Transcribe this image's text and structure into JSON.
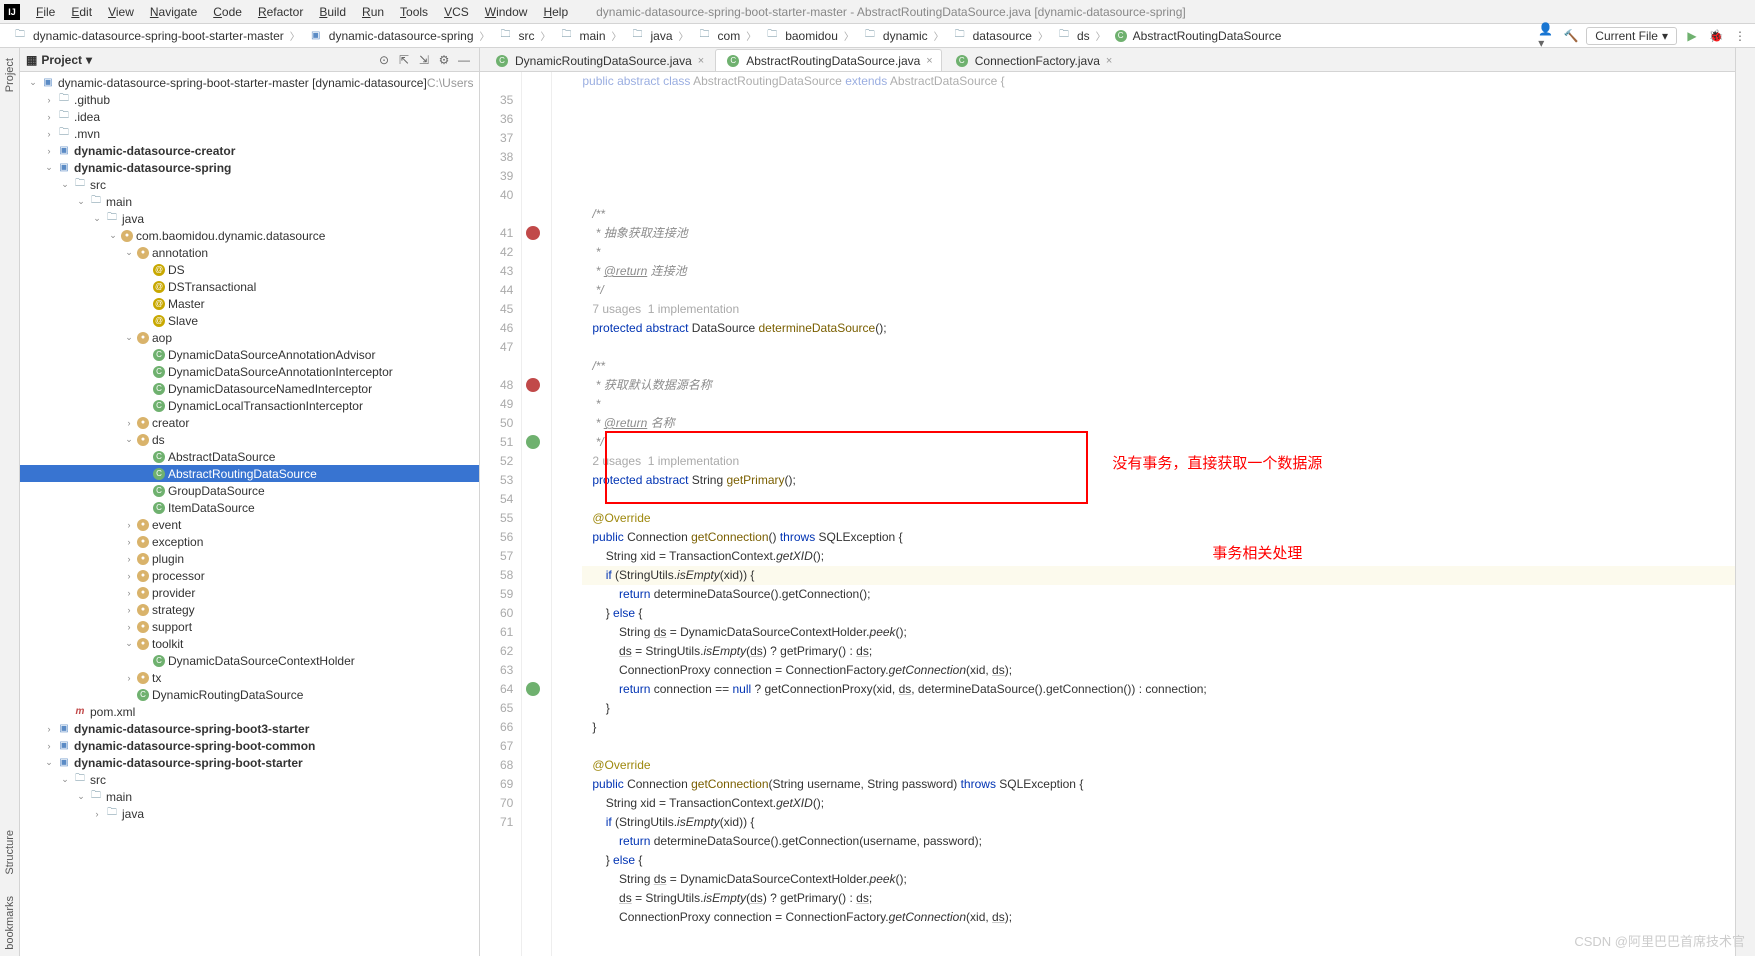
{
  "window": {
    "title": "dynamic-datasource-spring-boot-starter-master - AbstractRoutingDataSource.java [dynamic-datasource-spring]"
  },
  "menu": [
    "File",
    "Edit",
    "View",
    "Navigate",
    "Code",
    "Refactor",
    "Build",
    "Run",
    "Tools",
    "VCS",
    "Window",
    "Help"
  ],
  "breadcrumbs": [
    {
      "label": "dynamic-datasource-spring-boot-starter-master",
      "icon": "folder"
    },
    {
      "label": "dynamic-datasource-spring",
      "icon": "module"
    },
    {
      "label": "src",
      "icon": "folder"
    },
    {
      "label": "main",
      "icon": "folder"
    },
    {
      "label": "java",
      "icon": "folder"
    },
    {
      "label": "com",
      "icon": "folder"
    },
    {
      "label": "baomidou",
      "icon": "folder"
    },
    {
      "label": "dynamic",
      "icon": "folder"
    },
    {
      "label": "datasource",
      "icon": "folder"
    },
    {
      "label": "ds",
      "icon": "folder"
    },
    {
      "label": "AbstractRoutingDataSource",
      "icon": "class"
    }
  ],
  "runConfig": "Current File",
  "panel": {
    "title": "Project"
  },
  "sideTabs": {
    "project": "Project",
    "bookmarks": "bookmarks",
    "structure": "Structure"
  },
  "tree": [
    {
      "d": 0,
      "e": "v",
      "i": "mod",
      "t": "dynamic-datasource-spring-boot-starter-master [dynamic-datasource]",
      "suf": "C:\\Users"
    },
    {
      "d": 1,
      "e": ">",
      "i": "fld",
      "t": ".github"
    },
    {
      "d": 1,
      "e": ">",
      "i": "fld",
      "t": ".idea"
    },
    {
      "d": 1,
      "e": ">",
      "i": "fld",
      "t": ".mvn"
    },
    {
      "d": 1,
      "e": ">",
      "i": "mod",
      "t": "dynamic-datasource-creator",
      "b": 1
    },
    {
      "d": 1,
      "e": "v",
      "i": "mod",
      "t": "dynamic-datasource-spring",
      "b": 1
    },
    {
      "d": 2,
      "e": "v",
      "i": "fld",
      "t": "src"
    },
    {
      "d": 3,
      "e": "v",
      "i": "fld",
      "t": "main"
    },
    {
      "d": 4,
      "e": "v",
      "i": "fld",
      "t": "java"
    },
    {
      "d": 5,
      "e": "v",
      "i": "pkg",
      "t": "com.baomidou.dynamic.datasource"
    },
    {
      "d": 6,
      "e": "v",
      "i": "pkg",
      "t": "annotation"
    },
    {
      "d": 7,
      "e": "",
      "i": "ann",
      "t": "DS"
    },
    {
      "d": 7,
      "e": "",
      "i": "ann",
      "t": "DSTransactional"
    },
    {
      "d": 7,
      "e": "",
      "i": "ann",
      "t": "Master"
    },
    {
      "d": 7,
      "e": "",
      "i": "ann",
      "t": "Slave"
    },
    {
      "d": 6,
      "e": "v",
      "i": "pkg",
      "t": "aop"
    },
    {
      "d": 7,
      "e": "",
      "i": "cls",
      "t": "DynamicDataSourceAnnotationAdvisor"
    },
    {
      "d": 7,
      "e": "",
      "i": "cls",
      "t": "DynamicDataSourceAnnotationInterceptor"
    },
    {
      "d": 7,
      "e": "",
      "i": "cls",
      "t": "DynamicDatasourceNamedInterceptor"
    },
    {
      "d": 7,
      "e": "",
      "i": "cls",
      "t": "DynamicLocalTransactionInterceptor"
    },
    {
      "d": 6,
      "e": ">",
      "i": "pkg",
      "t": "creator"
    },
    {
      "d": 6,
      "e": "v",
      "i": "pkg",
      "t": "ds"
    },
    {
      "d": 7,
      "e": "",
      "i": "cls",
      "t": "AbstractDataSource"
    },
    {
      "d": 7,
      "e": "",
      "i": "cls",
      "t": "AbstractRoutingDataSource",
      "sel": 1
    },
    {
      "d": 7,
      "e": "",
      "i": "cls",
      "t": "GroupDataSource"
    },
    {
      "d": 7,
      "e": "",
      "i": "cls",
      "t": "ItemDataSource"
    },
    {
      "d": 6,
      "e": ">",
      "i": "pkg",
      "t": "event"
    },
    {
      "d": 6,
      "e": ">",
      "i": "pkg",
      "t": "exception"
    },
    {
      "d": 6,
      "e": ">",
      "i": "pkg",
      "t": "plugin"
    },
    {
      "d": 6,
      "e": ">",
      "i": "pkg",
      "t": "processor"
    },
    {
      "d": 6,
      "e": ">",
      "i": "pkg",
      "t": "provider"
    },
    {
      "d": 6,
      "e": ">",
      "i": "pkg",
      "t": "strategy"
    },
    {
      "d": 6,
      "e": ">",
      "i": "pkg",
      "t": "support"
    },
    {
      "d": 6,
      "e": "v",
      "i": "pkg",
      "t": "toolkit"
    },
    {
      "d": 7,
      "e": "",
      "i": "cls",
      "t": "DynamicDataSourceContextHolder"
    },
    {
      "d": 6,
      "e": ">",
      "i": "pkg",
      "t": "tx"
    },
    {
      "d": 6,
      "e": "",
      "i": "cls",
      "t": "DynamicRoutingDataSource"
    },
    {
      "d": 2,
      "e": "",
      "i": "mvn",
      "t": "pom.xml"
    },
    {
      "d": 1,
      "e": ">",
      "i": "mod",
      "t": "dynamic-datasource-spring-boot3-starter",
      "b": 1
    },
    {
      "d": 1,
      "e": ">",
      "i": "mod",
      "t": "dynamic-datasource-spring-boot-common",
      "b": 1
    },
    {
      "d": 1,
      "e": "v",
      "i": "mod",
      "t": "dynamic-datasource-spring-boot-starter",
      "b": 1
    },
    {
      "d": 2,
      "e": "v",
      "i": "fld",
      "t": "src"
    },
    {
      "d": 3,
      "e": "v",
      "i": "fld",
      "t": "main"
    },
    {
      "d": 4,
      "e": ">",
      "i": "fld",
      "t": "java"
    }
  ],
  "tabs": [
    {
      "label": "DynamicRoutingDataSource.java",
      "active": false
    },
    {
      "label": "AbstractRoutingDataSource.java",
      "active": true
    },
    {
      "label": "ConnectionFactory.java",
      "active": false
    }
  ],
  "lineStart": 35,
  "codeLines": [
    {
      "n": 35,
      "h": ""
    },
    {
      "n": 36,
      "h": "   <span class='comment'>/**</span>"
    },
    {
      "n": 37,
      "h": "   <span class='comment'> * 抽象获取连接池</span>"
    },
    {
      "n": 38,
      "h": "   <span class='comment'> *</span>"
    },
    {
      "n": 39,
      "h": "   <span class='comment'> * <span class='comment-tag'>@return</span> 连接池</span>"
    },
    {
      "n": 40,
      "h": "   <span class='comment'> */</span>"
    },
    {
      "n": "",
      "h": "   <span class='comment' style='font-style:normal;color:#aaa'>7 usages  1 implementation</span>"
    },
    {
      "n": 41,
      "m": "r",
      "h": "   <span class='kw'>protected</span> <span class='kw'>abstract</span> DataSource <span class='method'>determineDataSource</span>();"
    },
    {
      "n": 42,
      "h": ""
    },
    {
      "n": 43,
      "h": "   <span class='comment'>/**</span>"
    },
    {
      "n": 44,
      "h": "   <span class='comment'> * 获取默认数据源名称</span>"
    },
    {
      "n": 45,
      "h": "   <span class='comment'> *</span>"
    },
    {
      "n": 46,
      "h": "   <span class='comment'> * <span class='comment-tag'>@return</span> 名称</span>"
    },
    {
      "n": 47,
      "h": "   <span class='comment'> */</span>"
    },
    {
      "n": "",
      "h": "   <span class='comment' style='font-style:normal;color:#aaa'>2 usages  1 implementation</span>"
    },
    {
      "n": 48,
      "m": "r",
      "h": "   <span class='kw'>protected</span> <span class='kw'>abstract</span> String <span class='method'>getPrimary</span>();"
    },
    {
      "n": 49,
      "h": ""
    },
    {
      "n": 50,
      "h": "   <span class='anno'>@Override</span>"
    },
    {
      "n": 51,
      "m": "g",
      "h": "   <span class='kw'>public</span> Connection <span class='method'>getConnection</span>() <span class='kw'>throws</span> SQLException {"
    },
    {
      "n": 52,
      "h": "       String xid = TransactionContext.<span class='call-i'>getXID</span>();"
    },
    {
      "n": 53,
      "hl": 1,
      "h": "       <span class='kw'>if</span> (StringUtils.<span class='call-i'>isEmpty</span>(xid)) {"
    },
    {
      "n": 54,
      "h": "           <span class='kw'>return</span> determineDataSource().getConnection();"
    },
    {
      "n": 55,
      "h": "       } <span class='kw'>else</span> {"
    },
    {
      "n": 56,
      "h": "           String <span class='under'>ds</span> = DynamicDataSourceContextHolder.<span class='call-i'>peek</span>();"
    },
    {
      "n": 57,
      "h": "           <span class='under'>ds</span> = StringUtils.<span class='call-i'>isEmpty</span>(<span class='under'>ds</span>) ? getPrimary() : <span class='under'>ds</span>;"
    },
    {
      "n": 58,
      "h": "           ConnectionProxy connection = ConnectionFactory.<span class='call-i'>getConnection</span>(xid, <span class='under'>ds</span>);"
    },
    {
      "n": 59,
      "h": "           <span class='kw'>return</span> connection == <span class='kw'>null</span> ? getConnectionProxy(xid, <span class='under'>ds</span>, determineDataSource().getConnection()) : connection;"
    },
    {
      "n": 60,
      "h": "       }"
    },
    {
      "n": 61,
      "h": "   }"
    },
    {
      "n": 62,
      "h": ""
    },
    {
      "n": 63,
      "h": "   <span class='anno'>@Override</span>"
    },
    {
      "n": 64,
      "m": "g",
      "h": "   <span class='kw'>public</span> Connection <span class='method'>getConnection</span>(String username, String password) <span class='kw'>throws</span> SQLException {"
    },
    {
      "n": 65,
      "h": "       String xid = TransactionContext.<span class='call-i'>getXID</span>();"
    },
    {
      "n": 66,
      "h": "       <span class='kw'>if</span> (StringUtils.<span class='call-i'>isEmpty</span>(xid)) {"
    },
    {
      "n": 67,
      "h": "           <span class='kw'>return</span> determineDataSource().getConnection(username, password);"
    },
    {
      "n": 68,
      "h": "       } <span class='kw'>else</span> {"
    },
    {
      "n": 69,
      "h": "           String <span class='under'>ds</span> = DynamicDataSourceContextHolder.<span class='call-i'>peek</span>();"
    },
    {
      "n": 70,
      "h": "           <span class='under'>ds</span> = StringUtils.<span class='call-i'>isEmpty</span>(<span class='under'>ds</span>) ? getPrimary() : <span class='under'>ds</span>;"
    },
    {
      "n": 71,
      "h": "           ConnectionProxy connection = ConnectionFactory.<span class='call-i'>getConnection</span>(xid, <span class='under'>ds</span>);"
    }
  ],
  "topCodeFragment": "<span class='kw'>public</span> <span class='kw'>abstract</span> <span class='kw'>class</span> AbstractRoutingDataSource <span class='kw'>extends</span> AbstractDataSource {",
  "annotations": {
    "note1": "没有事务，直接获取一个数据源",
    "note2": "事务相关处理"
  },
  "watermark": "CSDN @阿里巴巴首席技术官"
}
